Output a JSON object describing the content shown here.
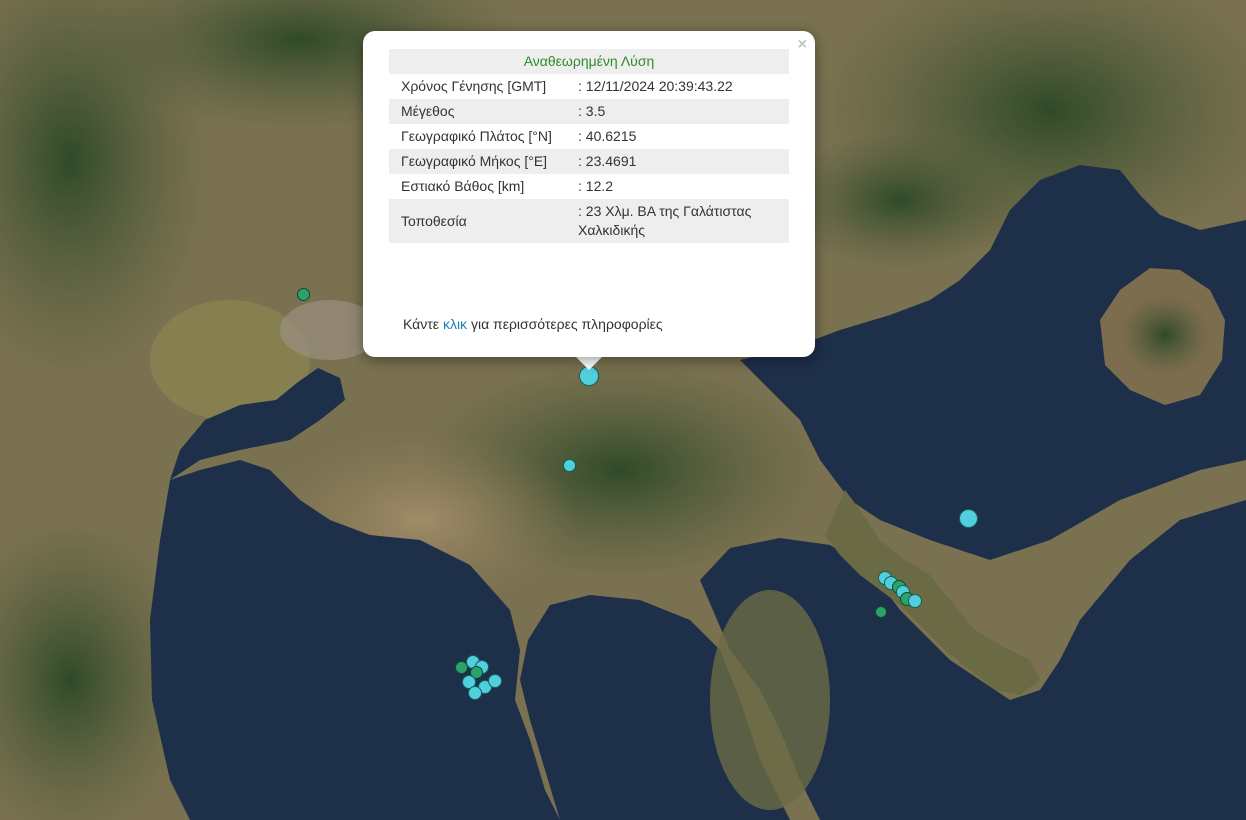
{
  "popup": {
    "title": "Αναθεωρημένη Λύση",
    "close_symbol": "×",
    "rows": [
      {
        "label": "Χρόνος Γένησης [GMT]",
        "value": ": 12/11/2024 20:39:43.22"
      },
      {
        "label": "Μέγεθος",
        "value": ": 3.5"
      },
      {
        "label": "Γεωγραφικό Πλάτος [°N]",
        "value": ": 40.6215"
      },
      {
        "label": "Γεωγραφικό Μήκος [°E]",
        "value": ": 23.4691"
      },
      {
        "label": "Εστιακό Βάθος [km]",
        "value": ": 12.2"
      },
      {
        "label": "Τοποθεσία",
        "value": ": 23 Χλμ. ΒΑ της Γαλάτιστας Χαλκιδικής"
      }
    ],
    "more_prefix": "Κάντε",
    "more_link": "κλικ",
    "more_suffix": "για περισσότερες πληροφορίες"
  },
  "colors": {
    "land": "#7a7150",
    "sea": "#1e2f4a",
    "forest": "#3d5a32",
    "marker_cyan": "#4fd0dc",
    "marker_green": "#2aa36b",
    "title_green": "#2e8b2e",
    "link_blue": "#1a7fb5"
  }
}
